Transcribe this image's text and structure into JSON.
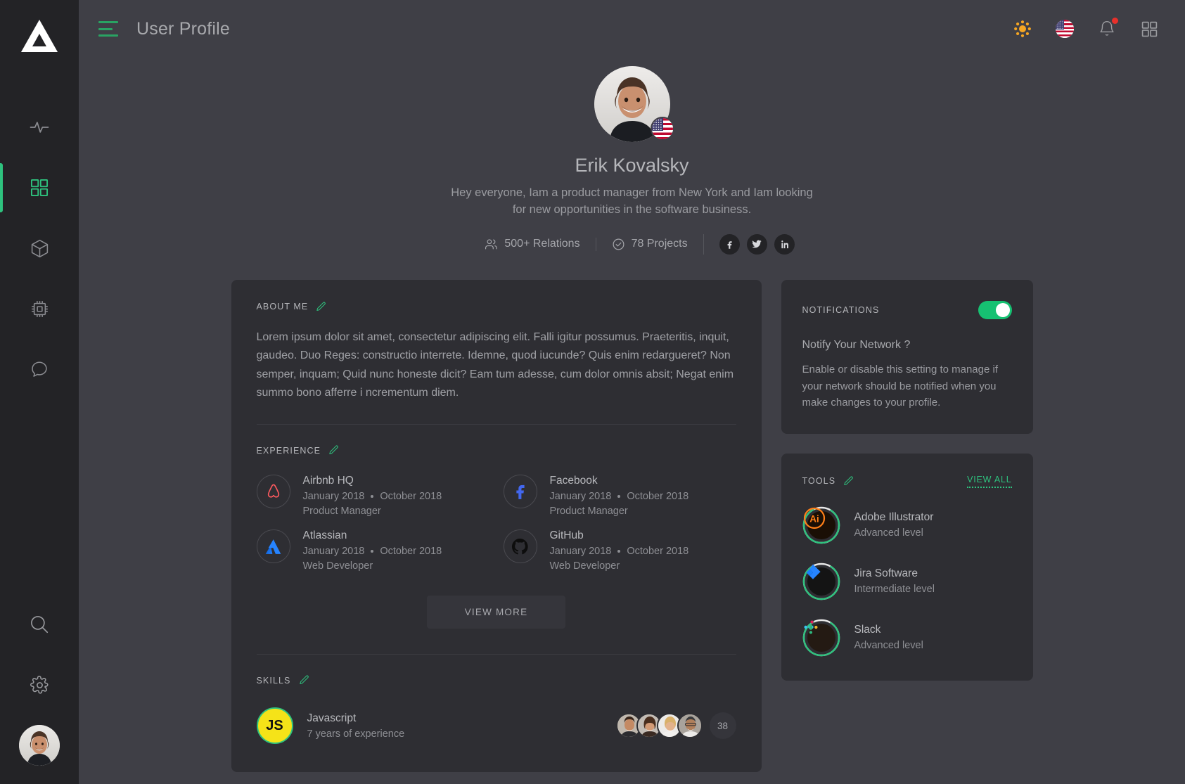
{
  "colors": {
    "accent_green": "#2ec27e",
    "toggle_on": "#16c172",
    "background": "#3f3f46",
    "sidebar": "#232326",
    "card": "#2e2e33",
    "notification_dot": "#e8302b"
  },
  "sidebar": {
    "logo_name": "triangle-logo",
    "items": [
      {
        "icon": "activity-pulse-icon",
        "name": "sidebar-item-activity",
        "active": false
      },
      {
        "icon": "grid-dashboard-icon",
        "name": "sidebar-item-dashboard",
        "active": true
      },
      {
        "icon": "cube-icon",
        "name": "sidebar-item-packages",
        "active": false
      },
      {
        "icon": "cpu-chip-icon",
        "name": "sidebar-item-hardware",
        "active": false
      },
      {
        "icon": "chat-bubble-icon",
        "name": "sidebar-item-messages",
        "active": false
      }
    ],
    "bottom_items": [
      {
        "icon": "search-icon",
        "name": "sidebar-item-search"
      },
      {
        "icon": "gear-icon",
        "name": "sidebar-item-settings"
      }
    ],
    "avatar_name": "sidebar-user-avatar"
  },
  "topbar": {
    "menu_icon": "hamburger-menu-icon",
    "title": "User Profile",
    "actions": [
      {
        "icon": "brightness-sun-icon",
        "name": "theme-toggle-button"
      },
      {
        "icon": "us-flag-icon",
        "name": "language-button"
      },
      {
        "icon": "bell-icon",
        "name": "notifications-button",
        "has_dot": true
      },
      {
        "icon": "grid-apps-icon",
        "name": "apps-grid-button"
      }
    ]
  },
  "profile": {
    "avatar_name": "profile-avatar",
    "flag_icon": "us-flag-badge-icon",
    "name": "Erik Kovalsky",
    "bio": "Hey everyone,  Iam a product manager from New York and Iam looking for new opportunities in the software business.",
    "stats": [
      {
        "icon": "users-icon",
        "label": "500+ Relations"
      },
      {
        "icon": "check-circle-icon",
        "label": "78 Projects"
      }
    ],
    "socials": [
      {
        "icon": "facebook-icon",
        "name": "social-facebook"
      },
      {
        "icon": "twitter-icon",
        "name": "social-twitter"
      },
      {
        "icon": "linkedin-icon",
        "name": "social-linkedin"
      }
    ]
  },
  "about": {
    "title": "ABOUT ME",
    "edit_icon": "pencil-edit-icon",
    "text": "Lorem ipsum dolor sit amet, consectetur adipiscing elit. Falli igitur possumus. Praeteritis, inquit, gaudeo. Duo Reges: constructio interrete. Idemne, quod iucunde? Quis enim redargueret? Non semper, inquam; Quid nunc honeste dicit? Eam tum adesse, cum dolor omnis absit; Negat enim summo bono afferre i ncrementum diem."
  },
  "experience": {
    "title": "EXPERIENCE",
    "edit_icon": "pencil-edit-icon",
    "view_more_label": "VIEW MORE",
    "items": [
      {
        "logo": "airbnb-icon",
        "company": "Airbnb HQ",
        "start": "January 2018",
        "end": "October 2018",
        "role": "Product Manager"
      },
      {
        "logo": "facebook-icon",
        "company": "Facebook",
        "start": "January 2018",
        "end": "October 2018",
        "role": "Product Manager"
      },
      {
        "logo": "atlassian-icon",
        "company": "Atlassian",
        "start": "January 2018",
        "end": "October 2018",
        "role": "Web Developer"
      },
      {
        "logo": "github-icon",
        "company": "GitHub",
        "start": "January 2018",
        "end": "October 2018",
        "role": "Web Developer"
      }
    ]
  },
  "skills": {
    "title": "SKILLS",
    "edit_icon": "pencil-edit-icon",
    "items": [
      {
        "badge": "JS",
        "name": "Javascript",
        "experience": "7 years of experience",
        "people_count": 4,
        "more_count": "38"
      }
    ]
  },
  "notifications": {
    "title": "NOTIFICATIONS",
    "toggle_on": true,
    "question": "Notify Your Network ?",
    "description": "Enable or disable this setting to manage if your network should be notified when you make changes to your profile."
  },
  "tools": {
    "title": "TOOLS",
    "edit_icon": "pencil-edit-icon",
    "view_all_label": "VIEW ALL",
    "items": [
      {
        "icon": "adobe-illustrator-icon",
        "name": "Adobe Illustrator",
        "level": "Advanced level",
        "progress": 85
      },
      {
        "icon": "jira-software-icon",
        "name": "Jira Software",
        "level": "Intermediate level",
        "progress": 85
      },
      {
        "icon": "slack-icon",
        "name": "Slack",
        "level": "Advanced level",
        "progress": 85
      }
    ]
  }
}
